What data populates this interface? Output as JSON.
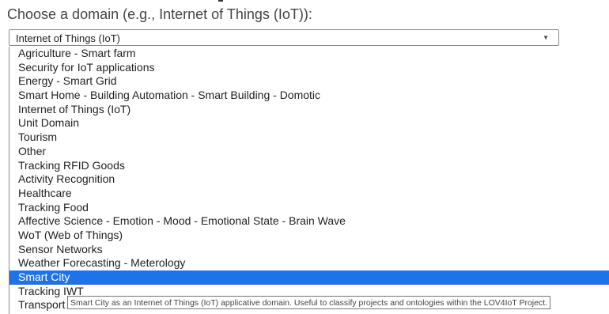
{
  "prompt": "Choose a domain (e.g., Internet of Things (IoT)):",
  "select": {
    "value": "Internet of Things (IoT)",
    "arrow_icon": "▼"
  },
  "options": [
    "Agriculture - Smart farm",
    "Security for IoT applications",
    "Energy - Smart Grid",
    "Smart Home - Building Automation - Smart Building - Domotic",
    "Internet of Things (IoT)",
    "Unit Domain",
    "Tourism",
    "Other",
    "Tracking RFID Goods",
    "Activity Recognition",
    "Healthcare",
    "Tracking Food",
    "Affective Science - Emotion - Mood - Emotional State - Brain Wave",
    "WoT (Web of Things)",
    "Sensor Networks",
    "Weather Forecasting - Meterology",
    "Smart City",
    "Tracking IWT",
    "Transport"
  ],
  "selected_option": "Smart City",
  "tooltip": "Smart City as an Internet of Things (IoT) applicative domain. Useful to classify projects and ontologies within the LOV4IoT Project."
}
